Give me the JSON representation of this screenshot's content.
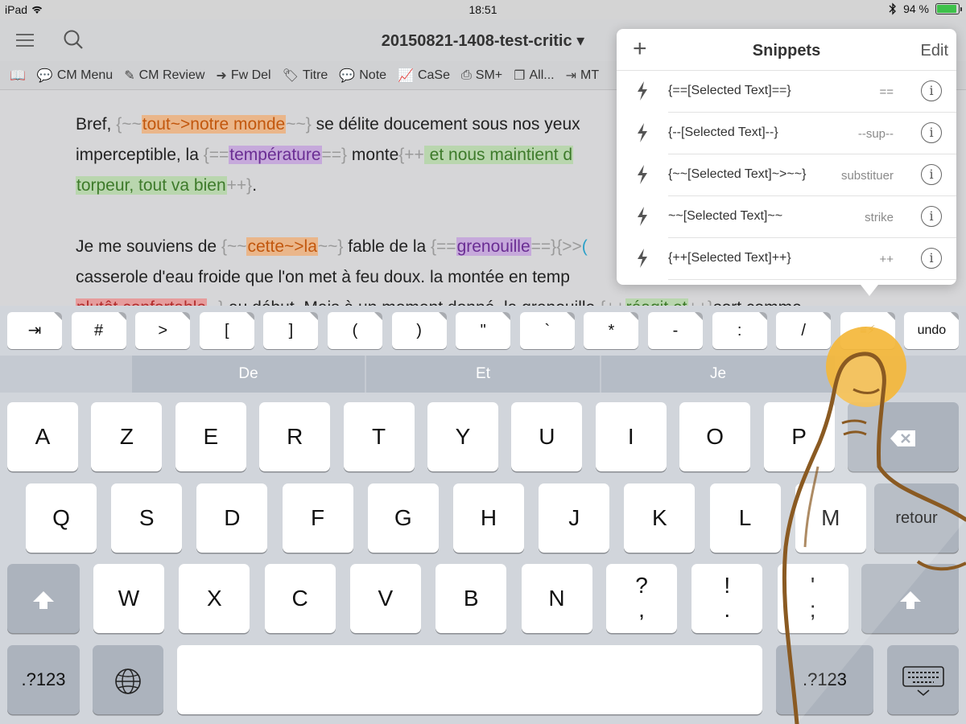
{
  "status": {
    "carrier": "iPad",
    "time": "18:51",
    "battery": "94 %",
    "battery_level": 0.94
  },
  "titlebar": {
    "title": "20150821-1408-test-critic ▾",
    "menu_icon": "hamburger-icon",
    "search_icon": "search-icon"
  },
  "toolbar": {
    "items": [
      {
        "icon": "book-icon",
        "glyph": "📖",
        "label": ""
      },
      {
        "icon": "speech-bubble-icon",
        "glyph": "💬",
        "label": "CM Menu"
      },
      {
        "icon": "pencil-icon",
        "glyph": "✎",
        "label": "CM Review"
      },
      {
        "icon": "arrow-circle-icon",
        "glyph": "➜",
        "label": "Fw Del"
      },
      {
        "icon": "tag-icon",
        "glyph": "🏷",
        "label": "Titre"
      },
      {
        "icon": "note-icon",
        "glyph": "💬",
        "label": "Note"
      },
      {
        "icon": "chart-icon",
        "glyph": "📈",
        "label": "CaSe"
      },
      {
        "icon": "printer-icon",
        "glyph": "⎙",
        "label": "SM+"
      },
      {
        "icon": "copy-icon",
        "glyph": "❐",
        "label": "All..."
      },
      {
        "icon": "export-icon",
        "glyph": "⇥",
        "label": "MT"
      }
    ]
  },
  "editor": {
    "p1l1": {
      "a": "Bref, ",
      "m1": "{~~",
      "s": "tout~>notre monde",
      "m2": "~~}",
      "b": " se délite doucement sous nos yeux"
    },
    "p1l2": {
      "a": "imperceptible, la ",
      "m1": "{==",
      "h": "température",
      "m2": "==}",
      "b": " monte",
      "m3": "{++",
      "i": " et nous maintient d"
    },
    "p1l3": {
      "i": "torpeur, tout va bien",
      "m": "++}",
      "b": "."
    },
    "p2l1": {
      "a": "Je me souviens de ",
      "m1": "{~~",
      "s": "cette~>la",
      "m2": "~~}",
      "b": " fable de la ",
      "m3": "{==",
      "h": "grenouille",
      "m4": "==}{>>",
      "c": "("
    },
    "p2l2": {
      "a": "casserole d'eau froide que l'on met à feu doux. la montée en temp"
    },
    "p2l3": {
      "d": "plutôt confortable",
      "m1": "--}",
      "b": " au début. Mais à un moment donné, la grenouille ",
      "m2": "{++",
      "i": "réagit et",
      "m3": "++}",
      "c": "sort comme"
    }
  },
  "snippets": {
    "title": "Snippets",
    "edit": "Edit",
    "add_icon": "plus-icon",
    "rows": [
      {
        "text": "{==[Selected Text]==}",
        "shortcut": "=="
      },
      {
        "text": "{--[Selected Text]--}",
        "shortcut": "--sup--"
      },
      {
        "text": "{~~[Selected Text]~>~~}",
        "shortcut": "substituer"
      },
      {
        "text": "~~[Selected Text]~~",
        "shortcut": "strike"
      },
      {
        "text": "{++[Selected Text]++}",
        "shortcut": "++"
      }
    ]
  },
  "keyboard": {
    "extra_keys": [
      "⇥",
      "#",
      ">",
      "[",
      "]",
      "(",
      ")",
      "\"",
      "`",
      "*",
      "-",
      ":",
      "/",
      "≡⚡",
      "undo"
    ],
    "predictions": [
      "De",
      "Et",
      "Je"
    ],
    "row1": [
      "A",
      "Z",
      "E",
      "R",
      "T",
      "Y",
      "U",
      "I",
      "O",
      "P"
    ],
    "row2": [
      "Q",
      "S",
      "D",
      "F",
      "G",
      "H",
      "J",
      "K",
      "L",
      "M"
    ],
    "row3": [
      "W",
      "X",
      "C",
      "V",
      "B",
      "N"
    ],
    "row3_punct": [
      {
        "top": "?",
        "bottom": ","
      },
      {
        "top": "!",
        "bottom": "."
      },
      {
        "top": "'",
        "bottom": ";"
      }
    ],
    "return": "retour",
    "numbers": ".?123",
    "globe_icon": "globe-icon",
    "shift_icon": "shift-icon",
    "backspace_icon": "backspace-icon",
    "hide_icon": "keyboard-hide-icon"
  },
  "colors": {
    "substitution": "#c2570d",
    "highlight": "#6a2d93",
    "insertion": "#3d7a2a",
    "deletion": "#b22d2d",
    "finger": "#f4b73a"
  }
}
